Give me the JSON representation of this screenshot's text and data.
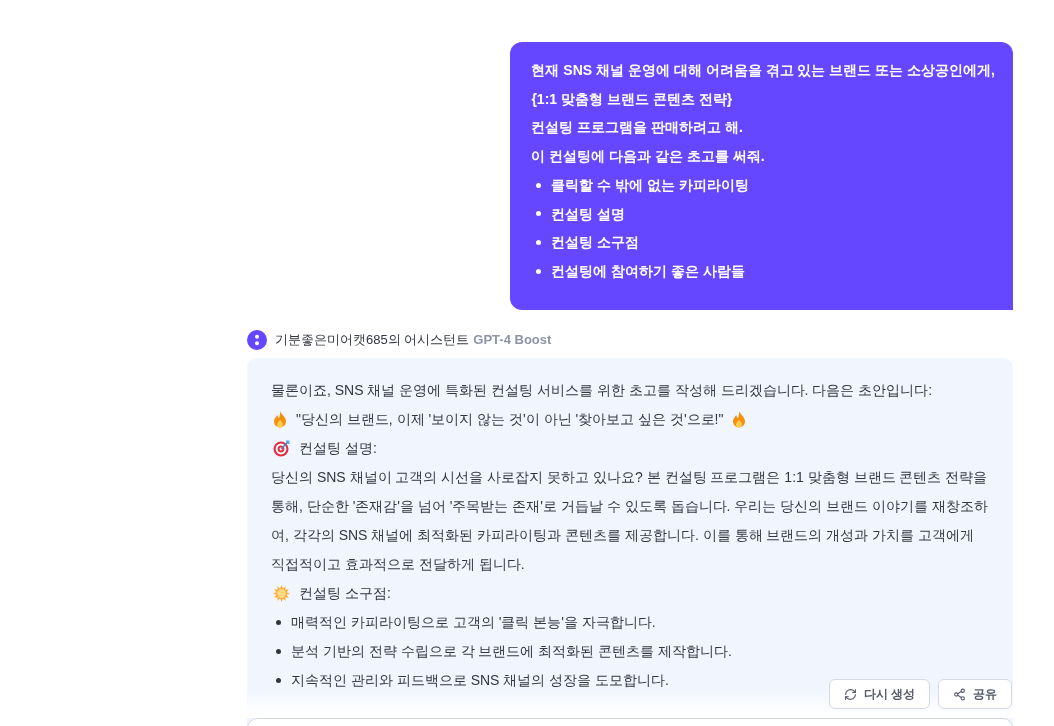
{
  "user_message": {
    "lines": [
      "현재 SNS 채널 운영에 대해 어려움을 겪고 있는 브랜드 또는 소상공인에게,",
      "{1:1 맞춤형 브랜드 콘텐츠 전략}",
      "컨설팅 프로그램을 판매하려고 해.",
      "이 컨설팅에 다음과 같은 초고를 써줘."
    ],
    "bullets": [
      "클릭할 수 밖에 없는 카피라이팅",
      "컨설팅 설명",
      "컨설팅 소구점",
      "컨설팅에 참여하기 좋은 사람들"
    ]
  },
  "assistant": {
    "name": "기분좋은미어캣685의 어시스턴트",
    "model": "GPT-4 Boost",
    "blocks": [
      {
        "kind": "paragraph",
        "text": "물론이죠, SNS 채널 운영에 특화된 컨설팅 서비스를 위한 초고를 작성해 드리겠습니다. 다음은 초안입니다:"
      },
      {
        "kind": "quote",
        "text": "\"당신의 브랜드, 이제 '보이지 않는 것'이 아닌 '찾아보고 싶은 것'으로!\""
      },
      {
        "kind": "heading",
        "text": "컨설팅 설명:"
      },
      {
        "kind": "paragraph",
        "text": "당신의 SNS 채널이 고객의 시선을 사로잡지 못하고 있나요? 본 컨설팅 프로그램은 1:1 맞춤형 브랜드 콘텐츠 전략을 통해, 단순한 '존재감'을 넘어 '주목받는 존재'로 거듭날 수 있도록 돕습니다. 우리는 당신의 브랜드 이야기를 재창조하여, 각각의 SNS 채널에 최적화된 카피라이팅과 콘텐츠를 제공합니다. 이를 통해 브랜드의 개성과 가치를 고객에게 직접적이고 효과적으로 전달하게 됩니다."
      },
      {
        "kind": "heading",
        "text": "컨설팅 소구점:"
      },
      {
        "kind": "bullets",
        "items": [
          "매력적인 카피라이팅으로 고객의 '클릭 본능'을 자극합니다.",
          "분석 기반의 전략 수립으로 각 브랜드에 최적화된 콘텐츠를 제작합니다.",
          "지속적인 관리와 피드백으로 SNS 채널의 성장을 도모합니다."
        ]
      }
    ]
  },
  "actions": [
    {
      "kind": "regenerate",
      "label": "다시 생성"
    },
    {
      "kind": "share",
      "label": "공유"
    }
  ]
}
